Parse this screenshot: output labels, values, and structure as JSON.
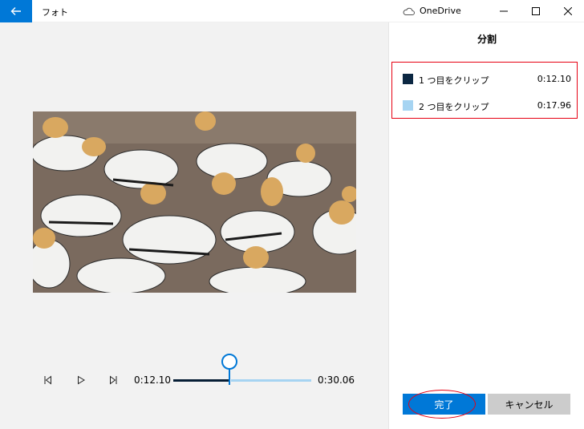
{
  "window": {
    "app_title": "フォト",
    "onedrive_label": "OneDrive"
  },
  "player": {
    "current_time": "0:12.10",
    "total_time": "0:30.06",
    "progress": 0.4025
  },
  "panel": {
    "title": "分割",
    "clips": [
      {
        "label": "1 つ目をクリップ",
        "time": "0:12.10",
        "color": "#0b2742"
      },
      {
        "label": "2 つ目をクリップ",
        "time": "0:17.96",
        "color": "#a6d4f2"
      }
    ],
    "done_label": "完了",
    "cancel_label": "キャンセル"
  },
  "colors": {
    "accent": "#0078d7",
    "annotation": "#e60012"
  }
}
